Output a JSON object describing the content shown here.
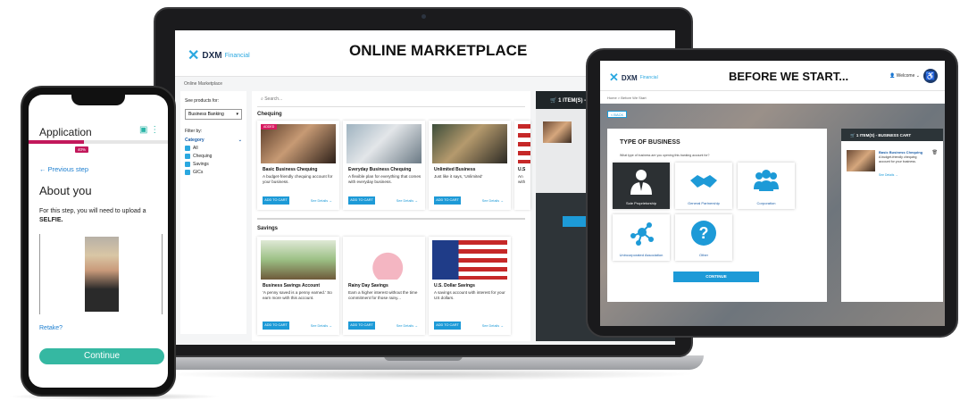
{
  "laptop": {
    "title": "ONLINE MARKETPLACE",
    "logo": {
      "brand": "DXM",
      "sub": "Financial"
    },
    "breadcrumb": "Online Marketplace",
    "sidebar": {
      "see_products_label": "See products for:",
      "select_value": "Business Banking",
      "filter_label": "Filter by:",
      "category_label": "Category",
      "filters": [
        "All",
        "Chequing",
        "Savings",
        "GICs"
      ]
    },
    "search_placeholder": "Search...",
    "sections": {
      "chequing": "Chequing",
      "savings": "Savings"
    },
    "badge": "ADDED",
    "cards_chequing": [
      {
        "title": "Basic Business Chequing",
        "desc": "A budget-friendly chequing account for your business."
      },
      {
        "title": "Everyday Business Chequing",
        "desc": "A flexible plan for everything that comes with everyday business."
      },
      {
        "title": "Unlimited Business",
        "desc": "Just like it says, 'Unlimited'"
      },
      {
        "title": "U.S",
        "desc": "An with"
      }
    ],
    "cards_savings": [
      {
        "title": "Business Savings Account",
        "desc": "'A penny saved is a penny earned.' So earn more with this account."
      },
      {
        "title": "Rainy Day Savings",
        "desc": "Earn a higher interest without the time commitment for those rainy..."
      },
      {
        "title": "U.S. Dollar Savings",
        "desc": "A savings account with interest for your US dollars."
      }
    ],
    "add_to_cart": "ADD TO CART",
    "see_details": "See Details →",
    "cart_header": "1 ITEM(S) - B"
  },
  "tablet": {
    "title": "BEFORE WE START...",
    "logo": {
      "brand": "DXM",
      "sub": "Financial"
    },
    "welcome": "Welcome",
    "breadcrumb": "Home > Before We Start",
    "back": "< BACK",
    "section_title": "TYPE OF BUSINESS",
    "question": "What type of business are you opening this banking account for?",
    "options": [
      "Sole Proprietorship",
      "General Partnership",
      "Corporation",
      "Unincorporated Association",
      "Other"
    ],
    "continue": "CONTINUE",
    "cart": {
      "header": "1 ITEM(S) - BUSINESS CART",
      "item_name": "Basic Business Chequing",
      "item_desc": "A budget-friendly chequing account for your business.",
      "see_details": "See Details →"
    }
  },
  "phone": {
    "title": "Application",
    "progress_pct": 40,
    "progress_label": "40%",
    "back": "← Previous step",
    "heading": "About you",
    "instruction_pre": "For this step, you will need to upload a",
    "instruction_strong": "SELFIE.",
    "retake": "Retake?",
    "continue": "Continue"
  },
  "colors": {
    "accent": "#1d9ad7",
    "brand_pink": "#c2185b",
    "teal": "#35b8a2"
  }
}
